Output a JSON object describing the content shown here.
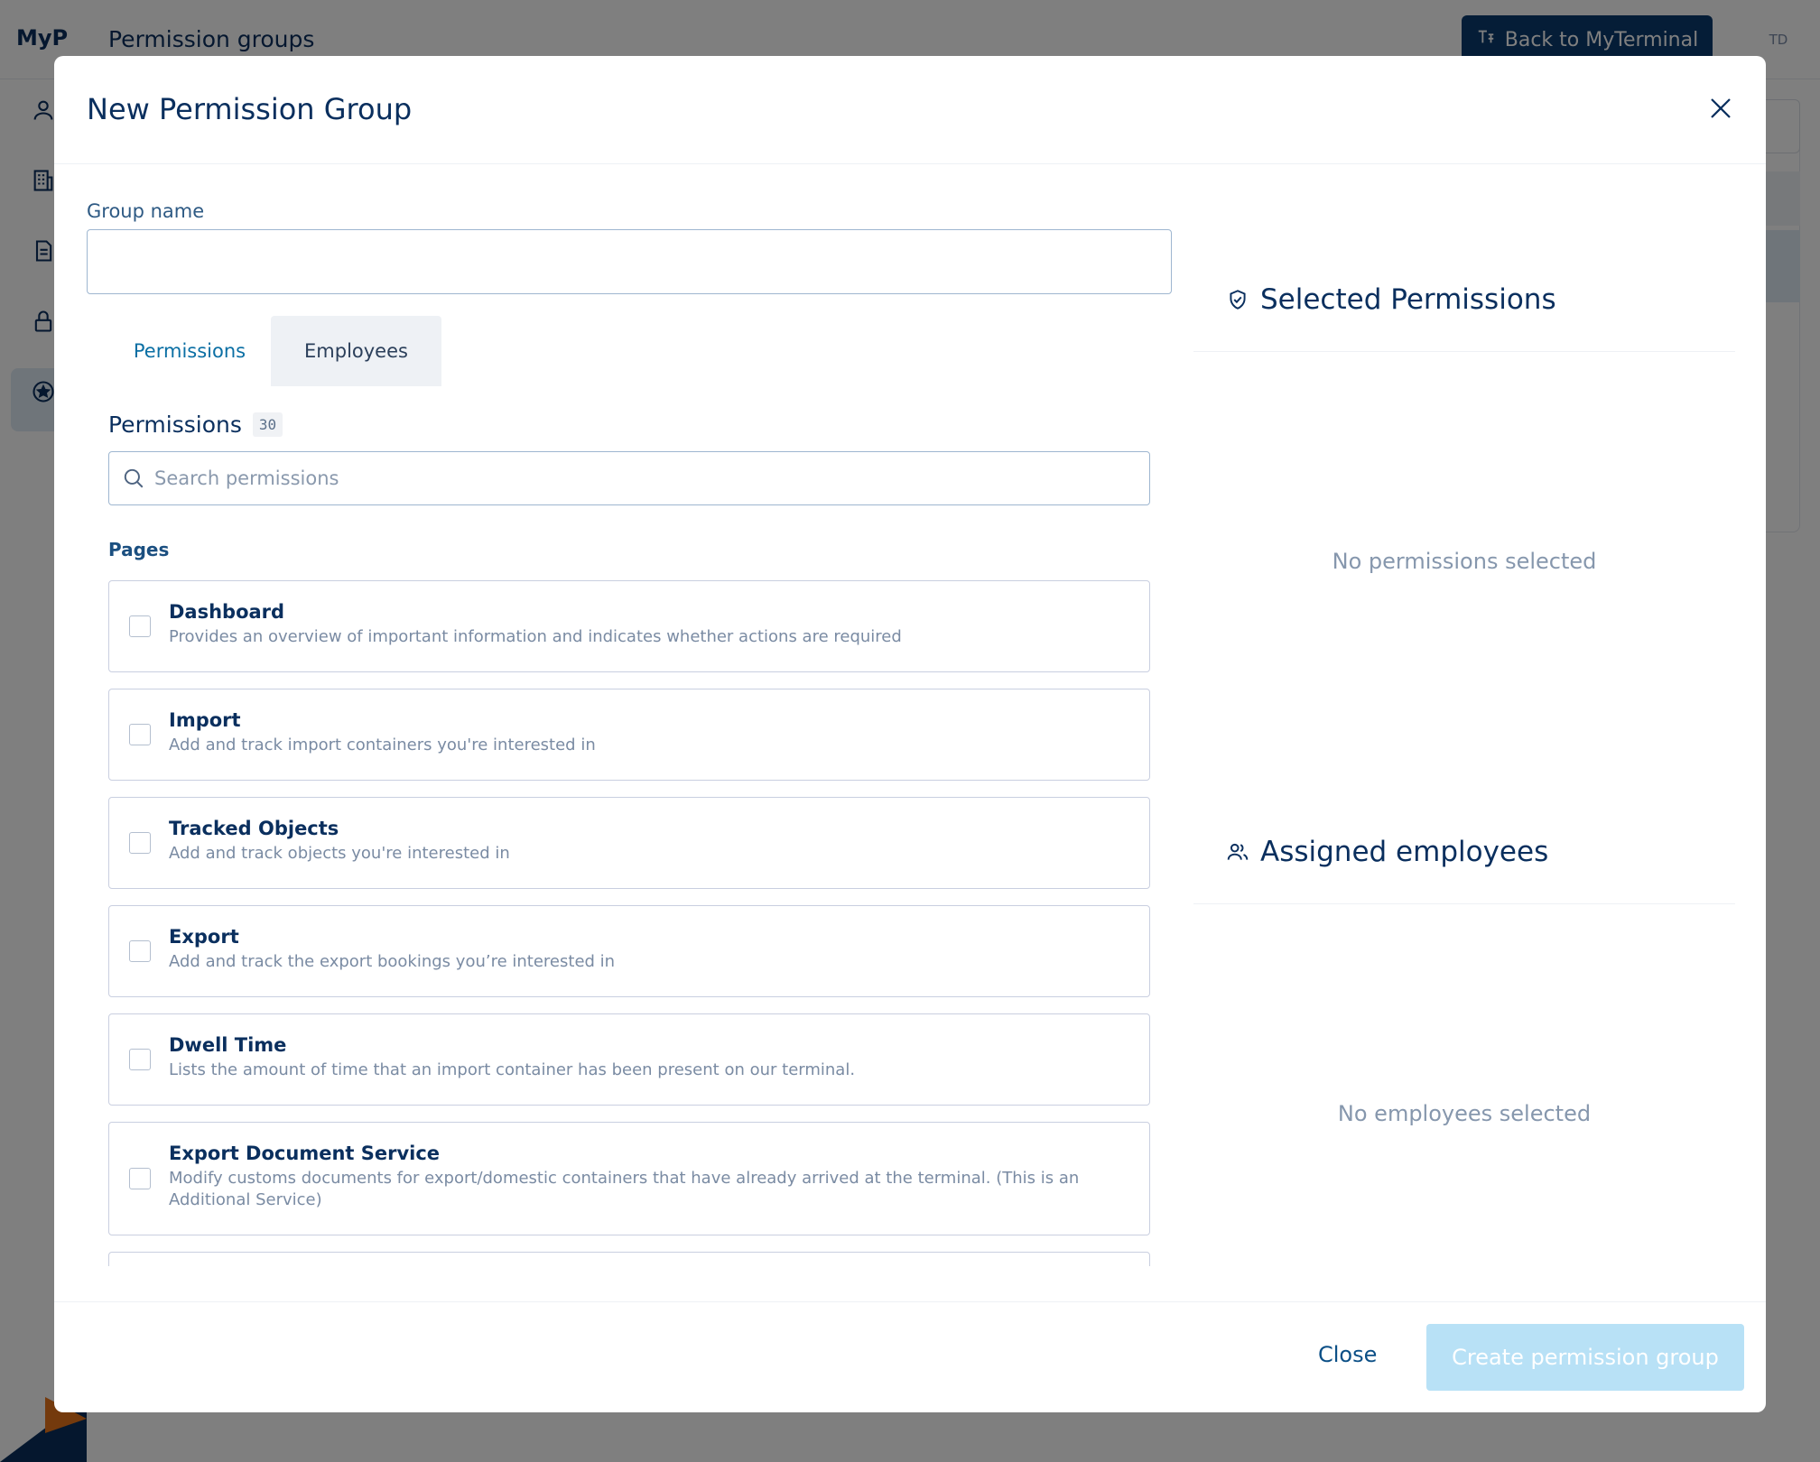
{
  "app": {
    "brand": "MyP",
    "page_title": "Permission groups",
    "back_button_label": "Back to MyTerminal",
    "avatar_initials": "TD"
  },
  "modal": {
    "title": "New Permission Group",
    "group_name_label": "Group name",
    "group_name_value": "",
    "tabs": [
      {
        "label": "Permissions",
        "active": true
      },
      {
        "label": "Employees",
        "active": false
      }
    ],
    "permissions_heading": "Permissions",
    "permissions_count": "30",
    "search_placeholder": "Search permissions",
    "section_label": "Pages",
    "permissions": [
      {
        "name": "Dashboard",
        "description": "Provides an overview of important information and indicates whether actions are required",
        "checked": false
      },
      {
        "name": "Import",
        "description": "Add and track import containers you're interested in",
        "checked": false
      },
      {
        "name": "Tracked Objects",
        "description": "Add and track objects you're interested in",
        "checked": false
      },
      {
        "name": "Export",
        "description": "Add and track the export bookings you’re interested in",
        "checked": false
      },
      {
        "name": "Dwell Time",
        "description": "Lists the amount of time that an import container has been present on our terminal.",
        "checked": false
      },
      {
        "name": "Export Document Service",
        "description": "Modify customs documents for export/domestic containers that have already arrived at the terminal. (This is an Additional Service)",
        "checked": false
      }
    ],
    "selected_permissions_title": "Selected Permissions",
    "selected_permissions_empty": "No permissions selected",
    "assigned_employees_title": "Assigned employees",
    "assigned_employees_empty": "No employees selected",
    "close_label": "Close",
    "create_label": "Create permission group"
  },
  "colors": {
    "primary_text": "#0a2f5e",
    "accent_link": "#0b6fa4",
    "create_button_disabled": "#b8e1f6",
    "back_button": "#0b3a6e"
  }
}
